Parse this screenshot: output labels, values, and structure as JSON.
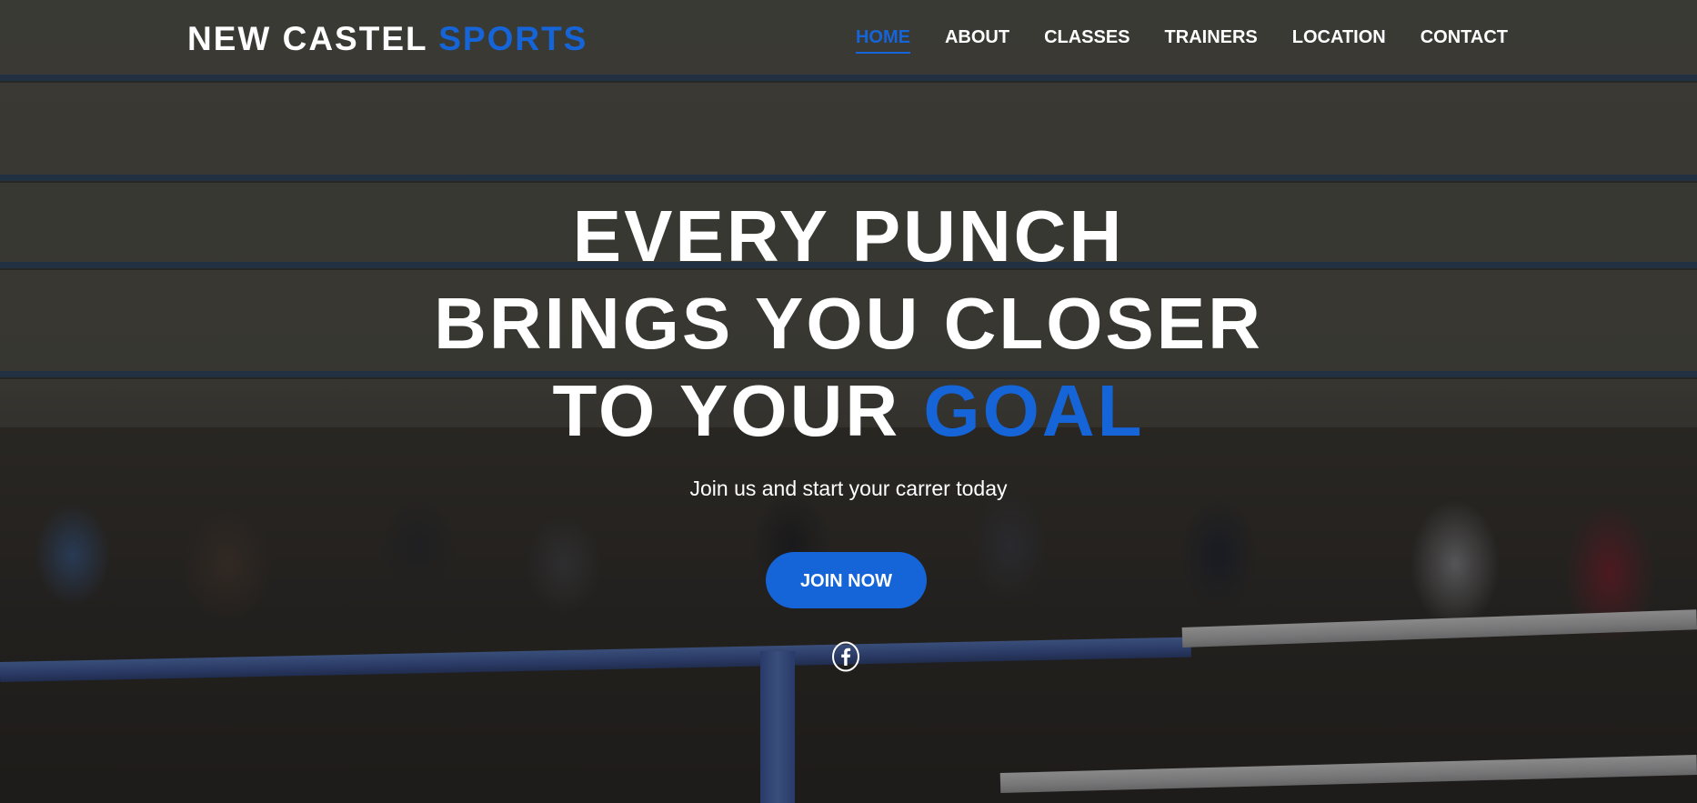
{
  "brand": {
    "name_part1": "NEW CASTEL",
    "name_part2": "SPORTS"
  },
  "nav": {
    "items": [
      {
        "label": "HOME",
        "active": true
      },
      {
        "label": "ABOUT",
        "active": false
      },
      {
        "label": "CLASSES",
        "active": false
      },
      {
        "label": "TRAINERS",
        "active": false
      },
      {
        "label": "LOCATION",
        "active": false
      },
      {
        "label": "CONTACT",
        "active": false
      }
    ]
  },
  "hero": {
    "headline_line1": "EVERY PUNCH",
    "headline_line2": "BRINGS YOU CLOSER",
    "headline_line3_prefix": "TO YOUR",
    "headline_line3_accent": "GOAL",
    "subtitle": "Join us and start your carrer today",
    "cta_label": "JOIN NOW"
  },
  "social": {
    "icons": [
      "facebook-icon"
    ]
  },
  "colors": {
    "accent": "#1565d8",
    "text": "#ffffff"
  }
}
